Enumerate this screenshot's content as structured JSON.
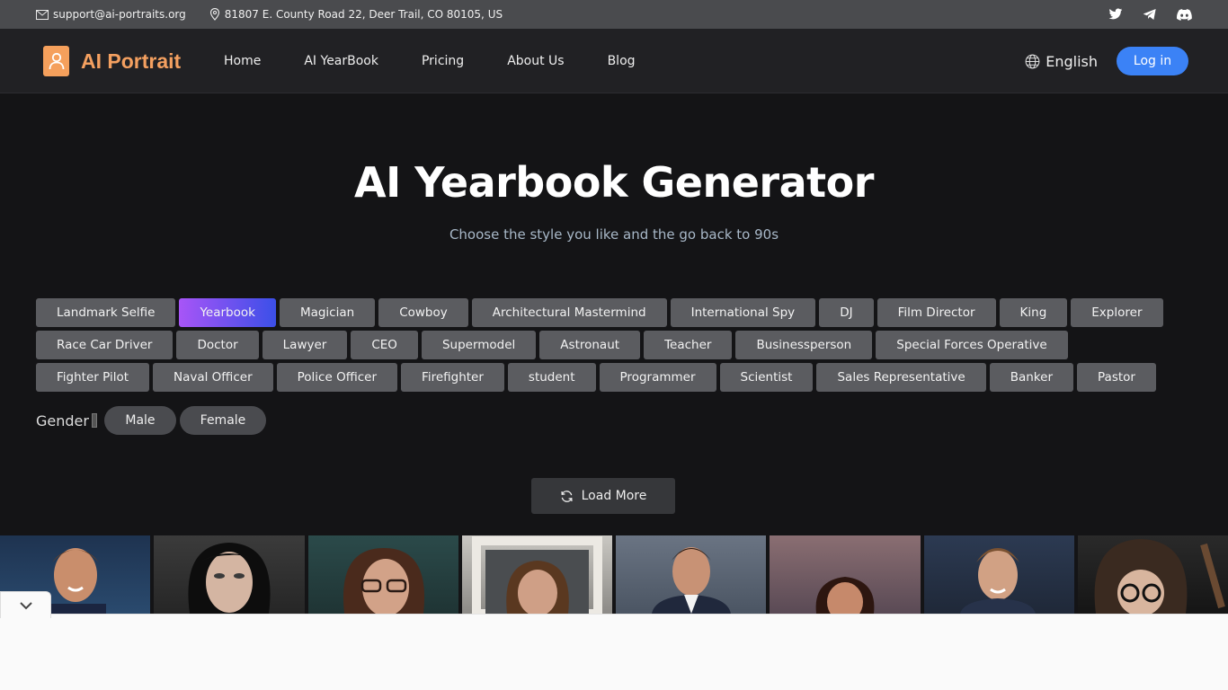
{
  "topbar": {
    "email": "support@ai-portraits.org",
    "address": "81807 E. County Road 22, Deer Trail, CO 80105, US",
    "social_icons": [
      "twitter-icon",
      "telegram-icon",
      "discord-icon"
    ]
  },
  "nav": {
    "brand": "AI Portrait",
    "links": [
      "Home",
      "AI YearBook",
      "Pricing",
      "About Us",
      "Blog"
    ],
    "language": "English",
    "login": "Log in"
  },
  "hero": {
    "title": "AI Yearbook Generator",
    "subtitle": "Choose the style you like and the go back to 90s"
  },
  "styles": {
    "selected": "Yearbook",
    "rows": [
      [
        "Landmark Selfie",
        "Yearbook",
        "Magician",
        "Cowboy",
        "Architectural Mastermind",
        "International Spy",
        "DJ",
        "Film Director",
        "King",
        "Explorer"
      ],
      [
        "Race Car Driver",
        "Doctor",
        "Lawyer",
        "CEO",
        "Supermodel",
        "Astronaut",
        "Teacher",
        "Businessperson",
        "Special Forces Operative"
      ],
      [
        "Fighter Pilot",
        "Naval Officer",
        "Police Officer",
        "Firefighter",
        "student",
        "Programmer",
        "Scientist",
        "Sales Representative",
        "Banker",
        "Pastor"
      ]
    ]
  },
  "gender": {
    "label": "Gender",
    "options": [
      "Male",
      "Female"
    ]
  },
  "load_more": "Load More",
  "colors": {
    "brand": "#f4a060",
    "accent": "#3b82f6",
    "chip_bg": "#5b5c60",
    "active_gradient_start": "#a855f7",
    "active_gradient_end": "#3b4fe8"
  }
}
